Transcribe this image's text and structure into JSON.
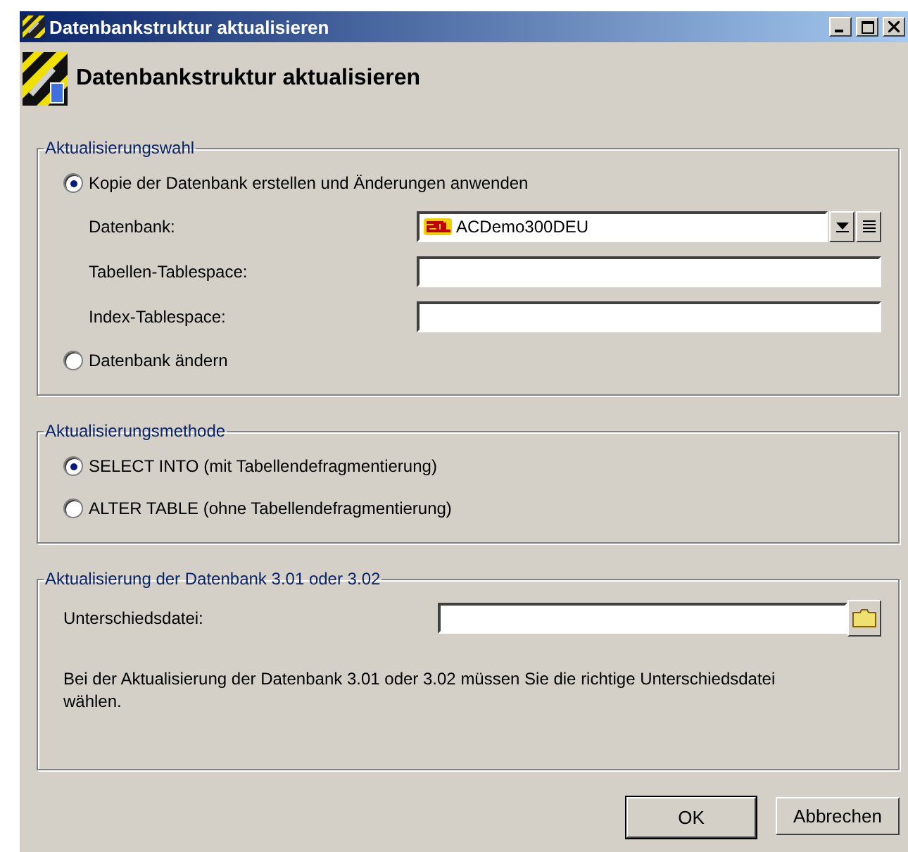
{
  "window": {
    "title": "Datenbankstruktur aktualisieren"
  },
  "header": {
    "title": "Datenbankstruktur aktualisieren"
  },
  "groups": [
    {
      "legend": "Aktualisierungswahl",
      "items": [
        {
          "kind": "radio",
          "label": "Kopie der Datenbank erstellen und Änderungen anwenden",
          "selected": true
        },
        {
          "kind": "combo",
          "label": "Datenbank:",
          "value": "ACDemo300DEU"
        },
        {
          "kind": "field",
          "label": "Tabellen-Tablespace:"
        },
        {
          "kind": "field",
          "label": "Index-Tablespace:"
        },
        {
          "kind": "radio",
          "label": "Datenbank ändern",
          "selected": false
        }
      ]
    },
    {
      "legend": "Aktualisierungsmethode",
      "items": [
        {
          "kind": "radio",
          "label": "SELECT INTO (mit Tabellendefragmentierung)",
          "selected": true
        },
        {
          "kind": "radio",
          "label": "ALTER TABLE (ohne Tabellendefragmentierung)",
          "selected": false
        }
      ]
    },
    {
      "legend": "Aktualisierung der Datenbank 3.01 oder 3.02",
      "items": [
        {
          "kind": "file",
          "label": "Unterschiedsdatei:"
        },
        {
          "kind": "note",
          "text": "Bei der Aktualisierung der Datenbank 3.01 oder 3.02 müssen Sie die richtige Unterschiedsdatei wählen."
        }
      ]
    }
  ],
  "buttons": [
    {
      "label": "OK",
      "default": true
    },
    {
      "label": "Abbrechen",
      "default": false
    }
  ]
}
